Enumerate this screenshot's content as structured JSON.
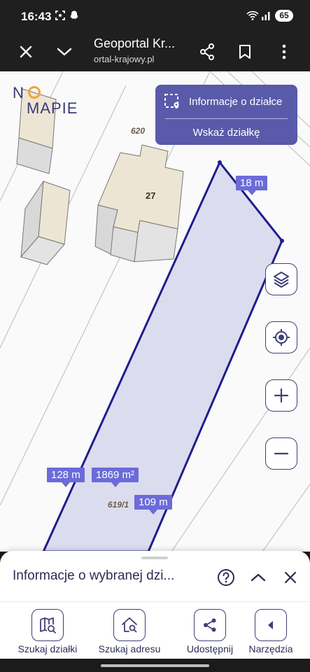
{
  "status_bar": {
    "time": "16:43",
    "battery": "65",
    "icons": [
      "screenshot-icon",
      "snapchat-icon",
      "wifi-icon",
      "signal-icon"
    ]
  },
  "browser": {
    "title": "Geoportal Kr...",
    "url": "ortal-krajowy.pl",
    "icons": [
      "close-icon",
      "chevron-down-icon",
      "share-icon",
      "bookmark-icon",
      "more-icon"
    ]
  },
  "map": {
    "logo_n": "N",
    "logo_mapie": "MAPIE",
    "info_panel": {
      "parcel_info_label": "Informacje o działce",
      "point_parcel_label": "Wskaż działkę"
    },
    "parcel_labels": {
      "north": "620",
      "selected": "619/1"
    },
    "building_number": "27",
    "measurements": {
      "top_edge": "18 m",
      "left_edge": "128 m",
      "area": "1869 m²",
      "right_edge": "109 m"
    },
    "controls": [
      "layers-icon",
      "locate-icon",
      "zoom-in-icon",
      "zoom-out-icon"
    ]
  },
  "sheet": {
    "title": "Informacje o wybranej dzi...",
    "icons": [
      "help-icon",
      "chevron-up-icon",
      "close-icon"
    ]
  },
  "bottom_nav": {
    "items": [
      {
        "label": "Szukaj działki",
        "icon": "map-search-icon"
      },
      {
        "label": "Szukaj adresu",
        "icon": "home-search-icon"
      },
      {
        "label": "Udostępnij",
        "icon": "share-icon"
      },
      {
        "label": "Narzędzia",
        "icon": "chevron-left-icon"
      }
    ]
  },
  "colors": {
    "accent": "#5a5aaa",
    "parcel_fill": "#d6d6ec",
    "parcel_stroke": "#1e1e8c",
    "measure_label": "#6b6bd9",
    "dark_text": "#2c2c55",
    "logo_orange": "#f2a33a"
  }
}
